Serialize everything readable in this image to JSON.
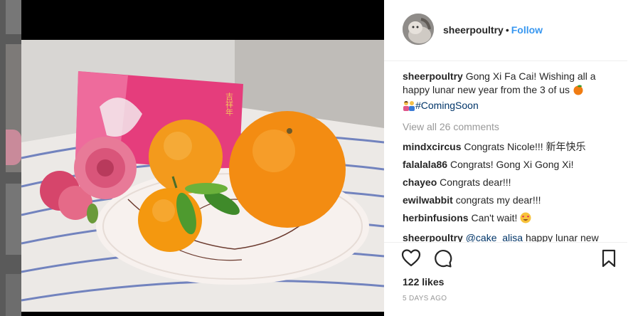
{
  "post": {
    "username": "sheerpoultry",
    "separator": "•",
    "follow_label": "Follow",
    "caption": {
      "user": "sheerpoultry",
      "text": "Gong Xi Fa Cai! Wishing all a happy lunar new year from the 3 of us",
      "hashtag": "#ComingSoon"
    },
    "view_all": "View all 26 comments",
    "comments": [
      {
        "user": "mindxcircus",
        "text": "Congrats Nicole!!! 新年快乐"
      },
      {
        "user": "falalala86",
        "text": "Congrats! Gong Xi Gong Xi!"
      },
      {
        "user": "chayeo",
        "text": "Congrats dear!!!"
      },
      {
        "user": "ewilwabbit",
        "text": "congrats my dear!!!"
      },
      {
        "user": "herbinfusions",
        "text": "Can't wait!"
      },
      {
        "user": "sheerpoultry",
        "mention": "@cake_alisa",
        "text": "happy lunar new"
      }
    ],
    "likes": "122 likes",
    "date": "5 DAYS AGO"
  },
  "icons": {
    "like": "heart-icon",
    "comment": "speech-bubble-icon",
    "save": "bookmark-icon"
  },
  "colors": {
    "link_blue": "#3897f0",
    "hashtag_blue": "#003569",
    "muted_gray": "#999999",
    "text": "#262626"
  }
}
